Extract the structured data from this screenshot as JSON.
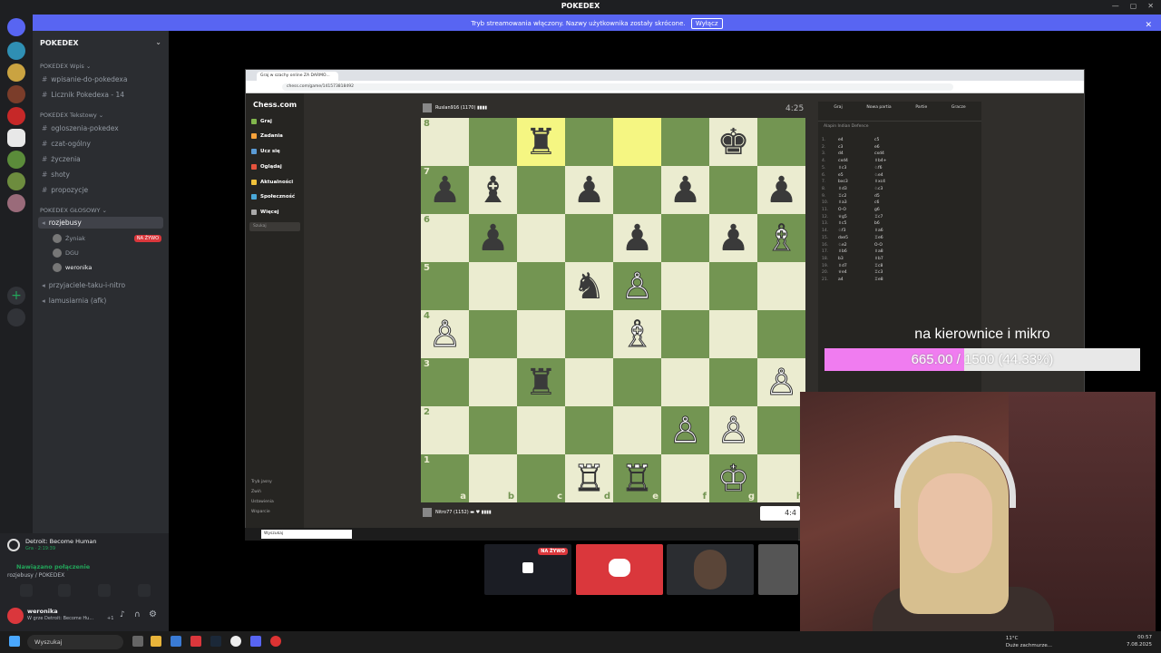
{
  "window": {
    "title": "POKEDEX",
    "controls": [
      "—",
      "▢",
      "✕"
    ]
  },
  "streaming_banner": {
    "text": "Tryb streamowania włączony. Nazwy użytkownika zostały skrócone.",
    "button": "Wyłącz",
    "close": "✕"
  },
  "sidebar": {
    "server_name": "POKEDEX",
    "categories": [
      {
        "label": "POKEDEX Wpis ⌄",
        "channels": [
          "wpisanie-do-pokedexa",
          "Licznik Pokedexa - 14"
        ]
      },
      {
        "label": "POKEDEX Tekstowy ⌄",
        "channels": [
          "ogloszenia-pokedex",
          "czat-ogólny",
          "życzenia",
          "shoty",
          "propozycje"
        ]
      },
      {
        "label": "POKEDEX GŁOSOWY ⌄",
        "channels": [
          "rozjebusy",
          "przyjaciele-taku-i-nitro",
          "lamusiarnia (afk)"
        ]
      }
    ],
    "voice_users": [
      {
        "name": "Żyniak",
        "live": "NA ŻYWO"
      },
      {
        "name": "DGU",
        "live": ""
      },
      {
        "name": "weronika",
        "live": ""
      }
    ]
  },
  "activity": {
    "game": "Detroit: Become Human",
    "time": "Gra · 2:19:39"
  },
  "voice": {
    "status": "Nawiązano połączenie",
    "channel": "rozjebusy / POKEDEX"
  },
  "user": {
    "name": "weronika",
    "status": "W grze Detroit: Become Hu...",
    "extra": "+1"
  },
  "browser": {
    "tab": "Graj w szachy online ZA DARMO...",
    "url": "chess.com/game/141573818492",
    "nav": {
      "logo": "Chess.com",
      "items": [
        "Graj",
        "Zadania",
        "Ucz się",
        "Oglądaj",
        "Aktualności",
        "Społeczność",
        "Więcej"
      ],
      "search_placeholder": "Szukaj",
      "bottom": [
        "Tryb jasny",
        "Zwiń",
        "Ustawienia",
        "Wsparcie"
      ]
    },
    "top_player": {
      "name": "Ruslan916 (1170) ▮▮▮▮",
      "clock": "4:25"
    },
    "bottom_player": {
      "name": "Nitro77 (1152) ▬ ♥ ▮▮▮▮",
      "clock": "4:4"
    },
    "right_tabs": [
      "Graj",
      "Nowa partia",
      "Partie",
      "Gracze"
    ],
    "opening": "Alapin Indian Defence",
    "moves": [
      [
        "1.",
        "e4",
        "c5"
      ],
      [
        "2.",
        "c3",
        "e6"
      ],
      [
        "3.",
        "d4",
        "cxd4"
      ],
      [
        "4.",
        "cxd4",
        "♗b4+"
      ],
      [
        "5.",
        "♗c3",
        "♘f6"
      ],
      [
        "6.",
        "e5",
        "♘e4"
      ],
      [
        "7.",
        "bxc3",
        "♗xc4"
      ],
      [
        "8.",
        "♗d3",
        "♘c3"
      ],
      [
        "9.",
        "♖c2",
        "d5"
      ],
      [
        "10.",
        "♗a3",
        "c6"
      ],
      [
        "11.",
        "O-O",
        "g6"
      ],
      [
        "12.",
        "♕g5",
        "♖c7"
      ],
      [
        "13.",
        "♗c5",
        "b6"
      ],
      [
        "14.",
        "♘f3",
        "♗a6"
      ],
      [
        "15.",
        "dxe5",
        "♖e6"
      ],
      [
        "16.",
        "♘e2",
        "O-O"
      ],
      [
        "17.",
        "♗b6",
        "♗a8"
      ],
      [
        "18.",
        "b3",
        "♗b7"
      ],
      [
        "19.",
        "♗d7",
        "♖c8"
      ],
      [
        "20.",
        "♕e4",
        "♖c3"
      ],
      [
        "21.",
        "a4",
        "♖e8"
      ]
    ]
  },
  "board": {
    "files": [
      "a",
      "b",
      "c",
      "d",
      "e",
      "f",
      "g",
      "h"
    ],
    "ranks": [
      "8",
      "7",
      "6",
      "5",
      "4",
      "3",
      "2",
      "1"
    ],
    "position": [
      [
        "",
        "",
        "b:♜",
        "",
        "",
        "",
        "b:♚",
        ""
      ],
      [
        "b:♟",
        "b:♝",
        "",
        "b:♟",
        "",
        "b:♟",
        "",
        "b:♟"
      ],
      [
        "",
        "b:♟",
        "",
        "",
        "b:♟",
        "",
        "b:♟",
        "w:♗"
      ],
      [
        "",
        "",
        "",
        "b:♞",
        "w:♙",
        "",
        "",
        ""
      ],
      [
        "w:♙",
        "",
        "",
        "",
        "w:♗",
        "",
        "",
        ""
      ],
      [
        "",
        "",
        "b:♜",
        "",
        "",
        "",
        "",
        "w:♙"
      ],
      [
        "",
        "",
        "",
        "",
        "",
        "w:♙",
        "w:♙",
        ""
      ],
      [
        "",
        "",
        "",
        "w:♖",
        "w:♖",
        "",
        "w:♔",
        ""
      ]
    ],
    "highlight": [
      [
        0,
        2
      ],
      [
        0,
        4
      ]
    ]
  },
  "goal": {
    "title": "na kierownice i mikro",
    "text": "665.00 / 1500 (44.33%)",
    "progress": 0.4433,
    "fill_color": "#f07cf0"
  },
  "tiles": {
    "live": "NA ŻYWO"
  },
  "taskbar": {
    "search": "Wyszukaj",
    "weather_temp": "11°C",
    "weather_desc": "Duże zachmurze...",
    "time": "00:57",
    "date": "7.08.2025"
  }
}
